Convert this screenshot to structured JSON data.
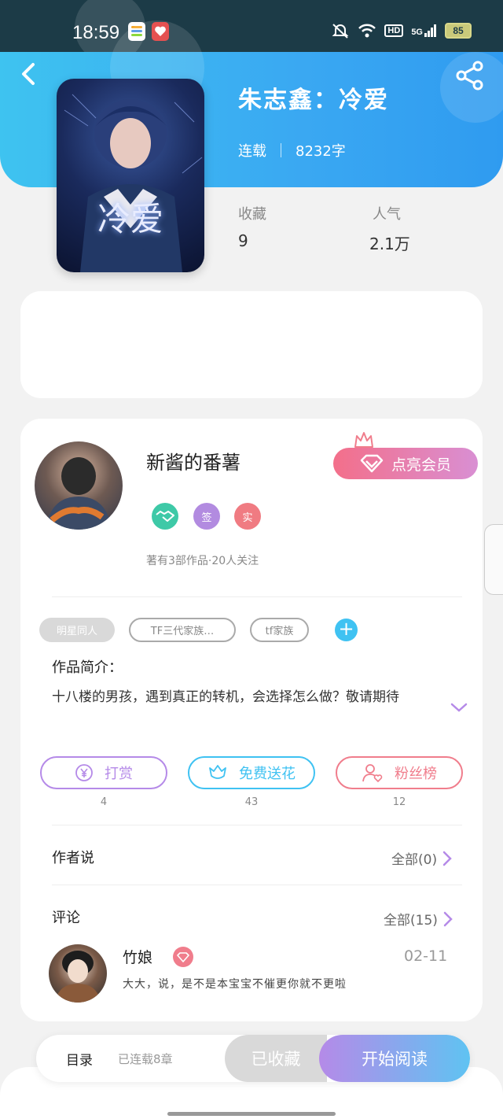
{
  "status_bar": {
    "time": "18:59",
    "network": "5G",
    "hd": "HD",
    "battery": "85"
  },
  "book": {
    "title": "朱志鑫：冷爱",
    "cover_text": "冷爱",
    "status": "连载",
    "word_count": "8232字",
    "stats": [
      {
        "label": "收藏",
        "value": "9"
      },
      {
        "label": "人气",
        "value": "2.1万"
      }
    ]
  },
  "author": {
    "name": "新酱的番薯",
    "vip_button": "点亮会员",
    "badges": [
      {
        "text": "签",
        "color": "#b28be0"
      },
      {
        "text": "实",
        "color": "#f07b82"
      }
    ],
    "stats_text": "著有3部作品·20人关注"
  },
  "tags": [
    "明星同人",
    "TF三代家族…",
    "tf家族"
  ],
  "intro": {
    "title": "作品简介：",
    "text": "十八楼的男孩，遇到真正的转机，会选择怎么做？敬请期待"
  },
  "actions": [
    {
      "label": "打赏",
      "count": "4",
      "color": "#b58ae8"
    },
    {
      "label": "免费送花",
      "count": "43",
      "color": "#3fc2f2"
    },
    {
      "label": "粉丝榜",
      "count": "12",
      "color": "#f07d8c"
    }
  ],
  "author_says": {
    "title": "作者说",
    "link": "全部(0)"
  },
  "comments": {
    "title": "评论",
    "link": "全部(15)",
    "items": [
      {
        "user": "竹娘",
        "date": "02-11",
        "text": "大大，说，是不是本宝宝不催更你就不更啦"
      }
    ]
  },
  "bottom_bar": {
    "toc": "目录",
    "toc_sub": "已连载8章",
    "favorited": "已收藏",
    "start_reading": "开始阅读"
  },
  "colors": {
    "header_blue": "#3aa8f2",
    "accent_purple": "#b58ae8",
    "accent_pink": "#f07d8c",
    "accent_cyan": "#3fc2f2"
  }
}
